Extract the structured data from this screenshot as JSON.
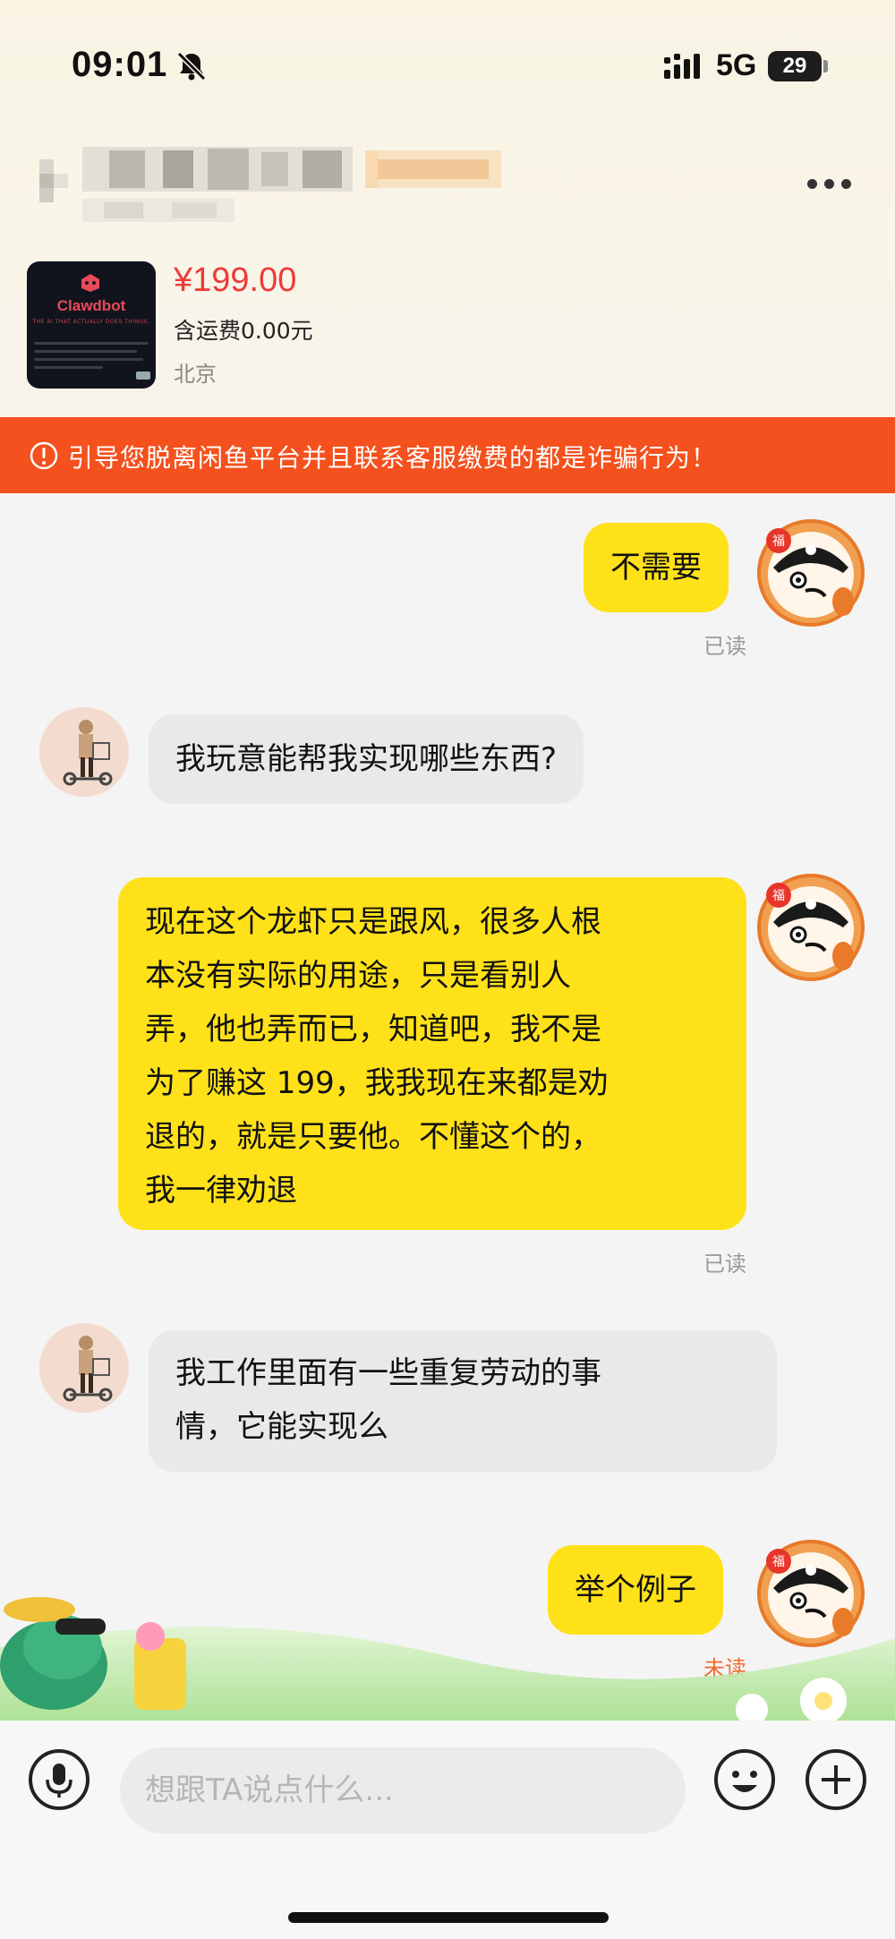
{
  "status_bar": {
    "time": "09:01",
    "network": "5G",
    "battery": "29"
  },
  "product": {
    "thumbnail_brand": "Clawdbot",
    "thumbnail_tagline": "THE AI THAT ACTUALLY DOES THINGS.",
    "price": "¥199.00",
    "shipping": "含运费0.00元",
    "location": "北京"
  },
  "warning": {
    "text": "引导您脱离闲鱼平台并且联系客服缴费的都是诈骗行为！"
  },
  "messages": [
    {
      "sender": "me",
      "text": "不需要",
      "status": "已读"
    },
    {
      "sender": "them",
      "text": "我玩意能帮我实现哪些东西?"
    },
    {
      "sender": "me",
      "lines": [
        "现在这个龙虾只是跟风，很多人根",
        "本没有实际的用途，只是看别人",
        "弄，他也弄而已，知道吧，我不是",
        "为了赚这 199，我我现在来都是劝",
        "退的，就是只要他。不懂这个的，",
        "我一律劝退"
      ],
      "status": "已读"
    },
    {
      "sender": "them",
      "lines": [
        "我工作里面有一些重复劳动的事",
        "情，它能实现么"
      ]
    },
    {
      "sender": "me",
      "text": "举个例子",
      "status": "未读"
    }
  ],
  "input": {
    "placeholder": "想跟TA说点什么..."
  },
  "icons": [
    "bell-off-icon",
    "signal-icon",
    "more-icon",
    "warning-icon",
    "mic-icon",
    "emoji-icon",
    "plus-icon"
  ],
  "colors": {
    "accent_yellow": "#ffe11a",
    "warning_orange": "#f4511e",
    "price_red": "#ef3a3a",
    "unread_orange": "#f06a2a"
  }
}
